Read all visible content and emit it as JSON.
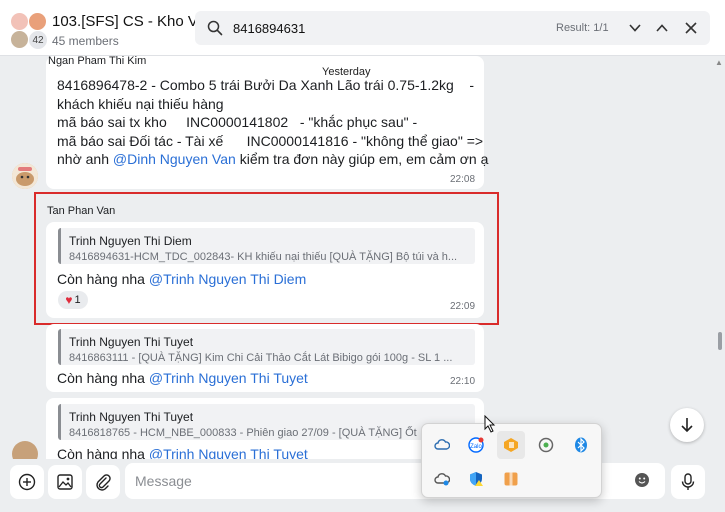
{
  "header": {
    "group_title": "103.[SFS] CS - Kho Vận",
    "members": "45 members",
    "avatar_count": "42"
  },
  "search": {
    "value": "8416894631",
    "result": "Result: 1/1"
  },
  "chat": {
    "date_divider": "Yesterday",
    "message1": {
      "sender": "Ngan Pham Thi Kim",
      "line1": "8416896478-2 - Combo 5 trái Bưởi Da Xanh Lão trái 0.75-1.2kg    -",
      "line2": "khách khiếu nại thiếu hàng",
      "line3": "mã báo sai tx kho     INC0000141802   - \"khắc phục sau\" -",
      "line4": "mã báo sai Đối tác - Tài xế      INC0000141816 - \"không thể giao\" =>",
      "line5_prefix": "nhờ anh ",
      "line5_mention": "@Dinh Nguyen Van",
      "line5_suffix": " kiểm tra đơn này giúp em, em cảm ơn ạ",
      "time": "22:08"
    },
    "message2": {
      "sender": "Tan Phan Van",
      "quote_name": "Trinh Nguyen Thi Diem",
      "quote_text": "8416894631-HCM_TDC_002843- KH khiếu nại thiếu [QUÀ TẶNG] Bộ túi và h...",
      "text_prefix": "Còn hàng nha ",
      "mention": "@Trinh Nguyen Thi Diem",
      "reaction_count": "1",
      "time": "22:09"
    },
    "message3": {
      "quote_name": "Trinh Nguyen Thi Tuyet",
      "quote_text": "8416863111 - [QUÀ TẶNG] Kim Chi Cải Thảo Cắt Lát Bibigo gói 100g - SL 1 ...",
      "text_prefix": "Còn hàng nha ",
      "mention": "@Trinh Nguyen Thi Tuyet",
      "time": "22:10"
    },
    "message4": {
      "quote_name": "Trinh Nguyen Thi Tuyet",
      "quote_text": "8416818765 - HCM_NBE_000833 - Phiên giao 27/09 - [QUÀ TẶNG] Ốt",
      "text_prefix": "Còn hàng nha ",
      "mention": "@Trinh Nguyen Thi Tuyet"
    }
  },
  "composer": {
    "placeholder": "Message"
  },
  "tray": {
    "icons": [
      "onedrive-icon",
      "zalo-icon",
      "app-orange-icon",
      "chrome-remote-icon",
      "bluetooth-icon",
      "cloud-sync-icon",
      "security-shield-icon",
      "archive-app-icon"
    ]
  },
  "colors": {
    "mention": "#2a6fd6",
    "highlight": "#d92b2b",
    "heart": "#e02b3c"
  }
}
